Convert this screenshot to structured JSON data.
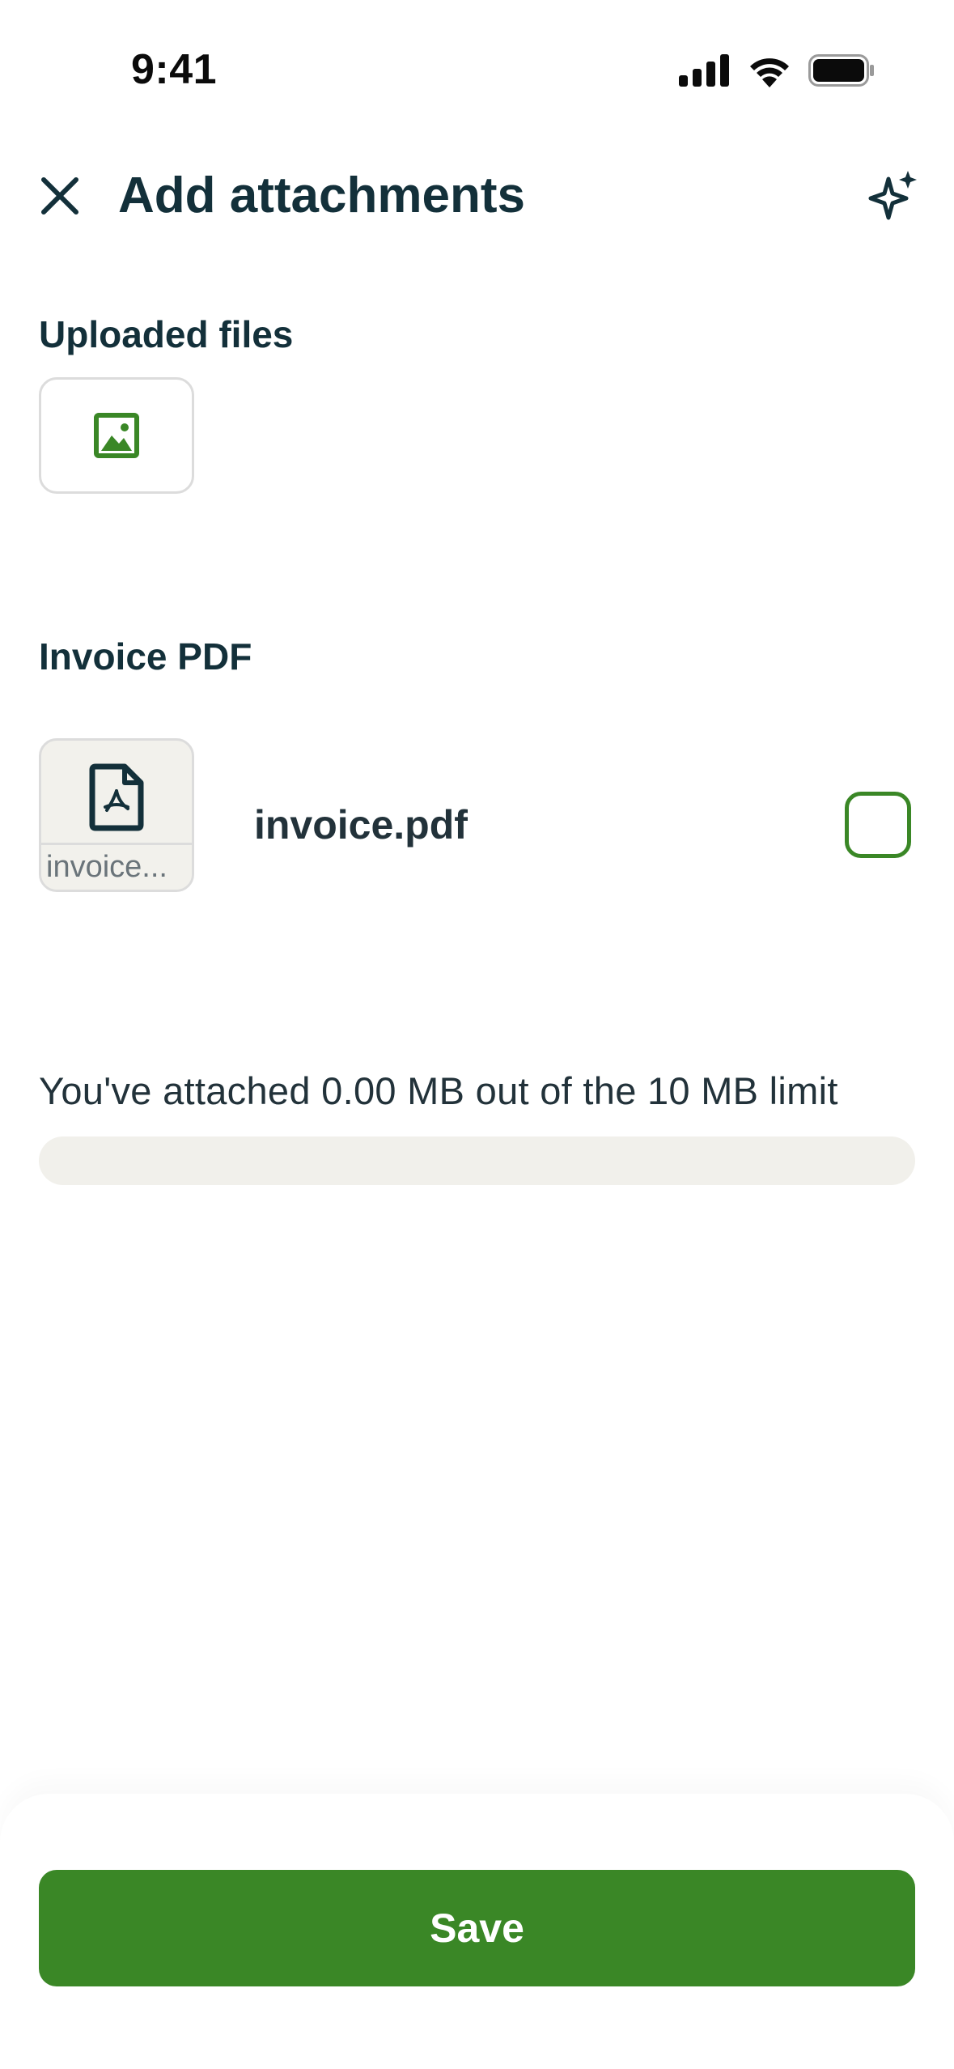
{
  "status_bar": {
    "time": "9:41"
  },
  "header": {
    "title": "Add attachments",
    "close_icon": "close-icon",
    "sparkle_icon": "sparkle-icon"
  },
  "uploaded_files": {
    "label": "Uploaded files",
    "items": [
      {
        "icon": "image-icon"
      }
    ]
  },
  "invoice_pdf": {
    "label": "Invoice PDF",
    "thumb_caption": "invoice...",
    "file_name": "invoice.pdf",
    "selected": false
  },
  "usage": {
    "text": "You've attached 0.00 MB out of the 10 MB limit",
    "progress_fraction": 0
  },
  "footer": {
    "save_label": "Save"
  },
  "colors": {
    "accent": "#3a8726",
    "text": "#13303a",
    "track": "#f1f0eb"
  }
}
